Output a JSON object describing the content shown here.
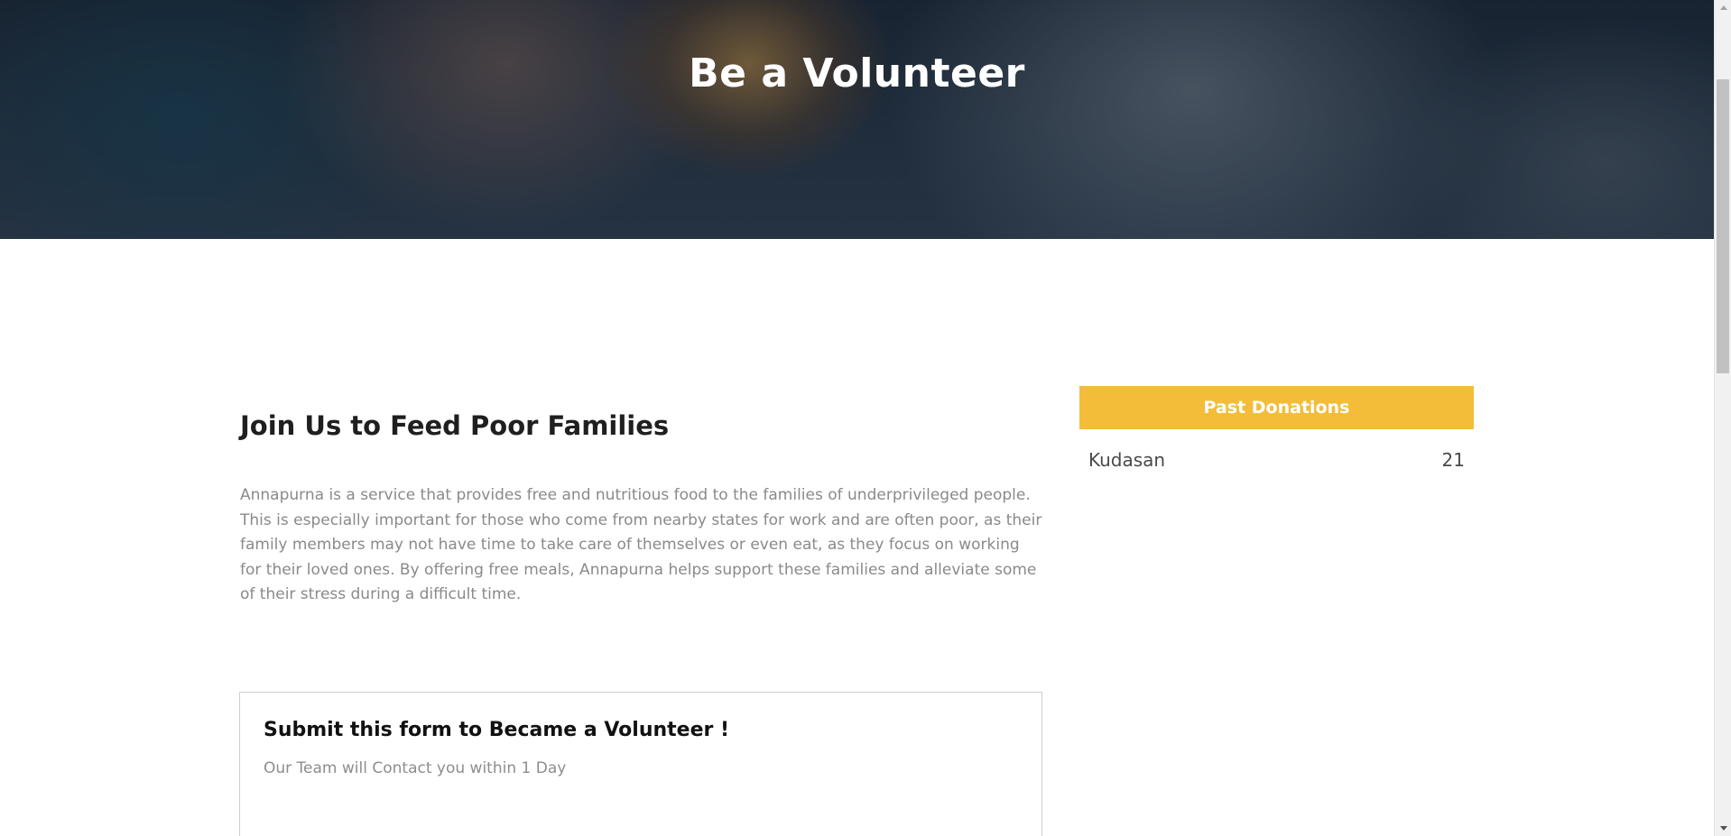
{
  "hero": {
    "title": "Be a Volunteer"
  },
  "main": {
    "heading": "Join Us to Feed Poor Families",
    "intro": "Annapurna is a service that provides free and nutritious food to the families of underprivileged people. This is especially important for those who come from nearby states for work and are often poor, as their family members may not have time to take care of themselves or even eat, as they focus on working for their loved ones. By offering free meals, Annapurna helps support these families and alleviate some of their stress during a difficult time."
  },
  "form": {
    "title": "Submit this form to Became a Volunteer !",
    "subtitle": "Our Team will Contact you within 1 Day"
  },
  "donations": {
    "header": "Past Donations",
    "items": [
      {
        "place": "Kudasan",
        "count": "21"
      }
    ]
  },
  "colors": {
    "accent": "#f3bd3a",
    "heading_text": "#1f1f1f",
    "body_text": "#8a8a8a"
  },
  "icons": {
    "scroll_up": "triangle-up",
    "scroll_down": "triangle-down"
  }
}
